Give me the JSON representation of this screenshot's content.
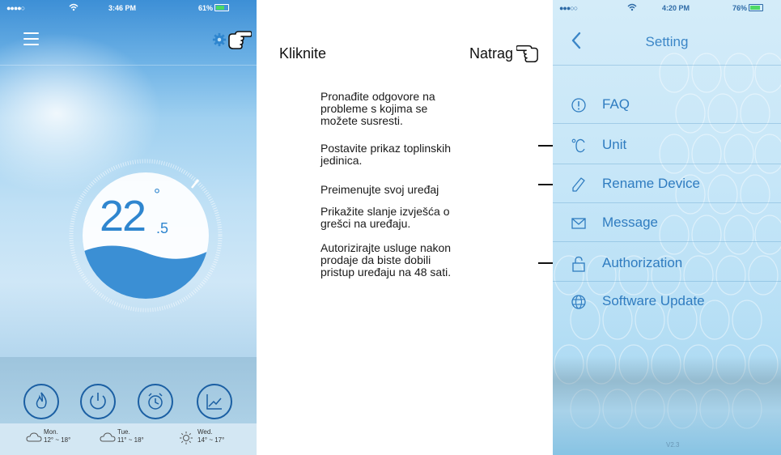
{
  "left_phone": {
    "status": {
      "signal": "●●●●○",
      "time": "3:46 PM",
      "battery": "61%"
    },
    "temperature": {
      "value": "22",
      "degree": "°",
      "decimal": ".5"
    },
    "controls": [
      "flame-icon",
      "power-icon",
      "alarm-clock-icon",
      "chart-icon"
    ],
    "forecast": [
      {
        "day": "Mon.",
        "range": "12° ~ 18°",
        "icon": "cloud-icon"
      },
      {
        "day": "Tue.",
        "range": "11° ~ 18°",
        "icon": "cloud-icon"
      },
      {
        "day": "Wed.",
        "range": "14° ~ 17°",
        "icon": "sun-icon"
      }
    ]
  },
  "callouts": {
    "click": "Kliknite",
    "back": "Natrag",
    "faq_desc": [
      "Pronađite odgovore na",
      "probleme s kojima se",
      "možete susresti."
    ],
    "unit_desc": [
      "Postavite prikaz toplinskih",
      "jedinica."
    ],
    "rename_desc": [
      "Preimenujte svoj uređaj"
    ],
    "message_desc": [
      "Prikažite slanje izvješća o",
      "grešci na uređaju."
    ],
    "auth_desc": [
      "Autorizirajte usluge nakon",
      "prodaje da biste dobili",
      "pristup uređaju na 48 sati."
    ]
  },
  "right_phone": {
    "status": {
      "signal": "●●●○○",
      "time": "4:20 PM",
      "battery": "76%"
    },
    "title": "Setting",
    "items": [
      {
        "label": "FAQ",
        "icon": "info-circle-icon"
      },
      {
        "label": "Unit",
        "icon": "celsius-icon"
      },
      {
        "label": "Rename Device",
        "icon": "pencil-icon"
      },
      {
        "label": "Message",
        "icon": "envelope-icon"
      },
      {
        "label": "Authorization",
        "icon": "padlock-icon"
      },
      {
        "label": "Software Update",
        "icon": "globe-icon"
      }
    ],
    "version": "V2.3"
  },
  "colors": {
    "accent": "#2f7cc0",
    "dial_blue": "#3b8fd4",
    "title_blue": "#3b86c7"
  }
}
